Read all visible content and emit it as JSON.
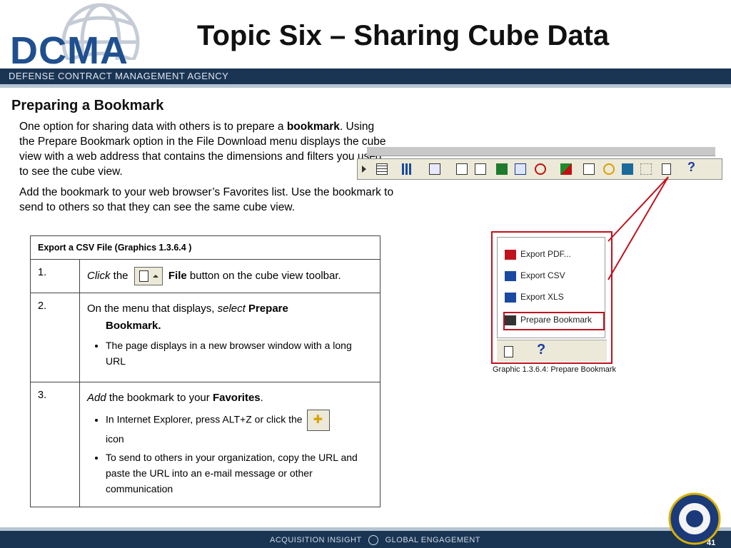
{
  "header": {
    "logo_text": "DCMA",
    "agency": "DEFENSE CONTRACT MANAGEMENT AGENCY",
    "title": "Topic Six – Sharing Cube Data"
  },
  "subtitle": "Preparing a Bookmark",
  "intro": {
    "p1_before": "One option for sharing data with others is to prepare a ",
    "p1_bold": "bookmark",
    "p1_after": ". Using the Prepare Bookmark option in the File Download menu displays the cube view with a web address that contains the dimensions and filters you used to see the cube view.",
    "p2": " Add the bookmark to your web browser’s Favorites list. Use the bookmark to send to others so that they can see the same cube view."
  },
  "table": {
    "header": "Export a CSV File (Graphics 1.3.6.4 )",
    "rows": [
      {
        "num": "1.",
        "italic": "Click",
        "text_a": " the",
        "bold": "File",
        "text_b": " button on the cube view toolbar."
      },
      {
        "num": "2.",
        "text_a": "On the menu that displays, ",
        "italic": "select",
        "bold1": "Prepare",
        "bold2": "Bookmark.",
        "bullets": [
          "The page displays in a new browser window with a long URL"
        ]
      },
      {
        "num": "3.",
        "italic": "Add",
        "text_a": " the bookmark to your ",
        "bold": "Favorites",
        "text_b": ".",
        "bullet1_a": "In Internet Explorer, press ALT+Z or click the",
        "bullet1_b": "icon",
        "bullet2": "To send to others in your organization, copy the URL and paste the URL into an e-mail message or other communication"
      }
    ]
  },
  "menu": {
    "items": [
      "Export PDF...",
      "Export CSV",
      "Export XLS",
      "Prepare Bookmark"
    ],
    "caption": "Graphic 1.3.6.4: Prepare Bookmark"
  },
  "footer": {
    "left": "ACQUISITION INSIGHT",
    "right": "GLOBAL ENGAGEMENT",
    "page": "41"
  },
  "colors": {
    "navy": "#1a3554",
    "logo_blue": "#1f4f8f",
    "highlight_red": "#c0121e"
  }
}
